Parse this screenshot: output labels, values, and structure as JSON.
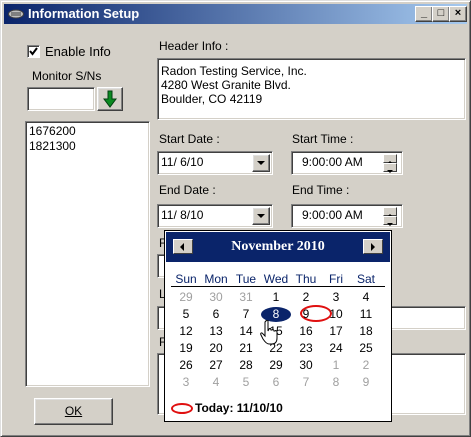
{
  "window": {
    "title": "Information Setup",
    "min_glyph": "_",
    "max_glyph": "□",
    "close_glyph": "×"
  },
  "left": {
    "enable_info_label": "Enable Info",
    "enable_info_checked": true,
    "monitor_label": "Monitor S/Ns",
    "serial_input_value": "",
    "serials": [
      "1676200",
      "1821300"
    ],
    "ok_label": "OK"
  },
  "header": {
    "label": "Header Info :",
    "lines": [
      "Radon Testing Service, Inc.",
      "4280 West Granite Blvd.",
      "Boulder, CO 42119"
    ]
  },
  "start": {
    "date_label": "Start Date :",
    "date_value": "11/ 6/10",
    "time_label": "Start Time :",
    "time_value": "9:00:00 AM"
  },
  "end": {
    "date_label": "End Date :",
    "date_value": "11/ 8/10",
    "time_label": "End Time :",
    "time_value": "9:00:00 AM"
  },
  "hidden_labels": {
    "l1": "F",
    "l2": "L",
    "l3": "F"
  },
  "calendar": {
    "month_title": "November 2010",
    "days_of_week": [
      "Sun",
      "Mon",
      "Tue",
      "Wed",
      "Thu",
      "Fri",
      "Sat"
    ],
    "weeks": [
      [
        "29",
        "30",
        "31",
        "1",
        "2",
        "3",
        "4"
      ],
      [
        "5",
        "6",
        "7",
        "8",
        "9",
        "10",
        "11"
      ],
      [
        "12",
        "13",
        "14",
        "15",
        "16",
        "17",
        "18"
      ],
      [
        "19",
        "20",
        "21",
        "22",
        "23",
        "24",
        "25"
      ],
      [
        "26",
        "27",
        "28",
        "29",
        "30",
        "1",
        "2"
      ],
      [
        "3",
        "4",
        "5",
        "6",
        "7",
        "8",
        "9"
      ]
    ],
    "selected_day": "8",
    "today_day": "10",
    "today_label": "Today: 11/10/10"
  },
  "colors": {
    "title_start": "#0a246a",
    "title_end": "#a6caf0",
    "face": "#d4d0c8",
    "selection": "#0a246a",
    "today_ring": "#e01010",
    "arrow_green": "#0a8a20"
  }
}
